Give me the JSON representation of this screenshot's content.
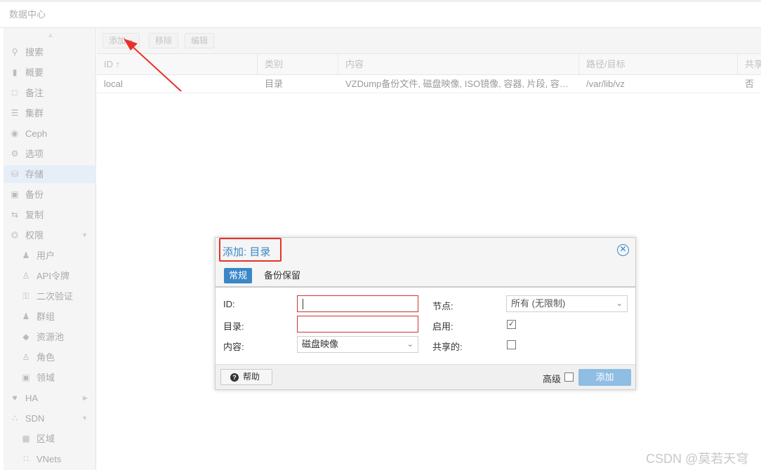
{
  "topbar": {
    "title": "数据中心"
  },
  "sidebar": {
    "items": [
      {
        "label": "搜索",
        "icon": "search-icon"
      },
      {
        "label": "概要",
        "icon": "book-icon"
      },
      {
        "label": "备注",
        "icon": "note-icon"
      },
      {
        "label": "集群",
        "icon": "server-icon"
      },
      {
        "label": "Ceph",
        "icon": "ceph-icon"
      },
      {
        "label": "选项",
        "icon": "gear-icon"
      },
      {
        "label": "存储",
        "icon": "database-icon",
        "active": true
      },
      {
        "label": "备份",
        "icon": "floppy-icon"
      },
      {
        "label": "复制",
        "icon": "retweet-icon"
      },
      {
        "label": "权限",
        "icon": "unlock-icon",
        "expanded": true
      },
      {
        "label": "用户",
        "icon": "user-icon"
      },
      {
        "label": "API令牌",
        "icon": "user-outline-icon"
      },
      {
        "label": "二次验证",
        "icon": "key-icon"
      },
      {
        "label": "群组",
        "icon": "users-icon"
      },
      {
        "label": "资源池",
        "icon": "tags-icon"
      },
      {
        "label": "角色",
        "icon": "male-icon"
      },
      {
        "label": "领域",
        "icon": "address-book-icon"
      },
      {
        "label": "HA",
        "icon": "heartbeat-icon"
      },
      {
        "label": "SDN",
        "icon": "sdn-icon",
        "expanded": true
      },
      {
        "label": "区域",
        "icon": "grid-icon"
      },
      {
        "label": "VNets",
        "icon": "sitemap-icon"
      }
    ]
  },
  "toolbar": {
    "add_label": "添加",
    "remove_label": "移除",
    "edit_label": "编辑"
  },
  "grid": {
    "columns": [
      "ID ↑",
      "类别",
      "内容",
      "路径/目标",
      "共享"
    ],
    "rows": [
      {
        "id": "local",
        "type": "目录",
        "content": "VZDump备份文件, 磁盘映像, ISO镜像, 容器, 片段, 容…",
        "path": "/var/lib/vz",
        "shared": "否"
      }
    ]
  },
  "dialog": {
    "title": "添加: 目录",
    "tabs": [
      "常规",
      "备份保留"
    ],
    "id_label": "ID:",
    "id_value": "",
    "directory_label": "目录:",
    "directory_value": "",
    "content_label": "内容:",
    "content_value": "磁盘映像",
    "nodes_label": "节点:",
    "nodes_value": "所有 (无限制)",
    "enable_label": "启用:",
    "enable_checked": true,
    "shared_label": "共享的:",
    "shared_checked": false,
    "help_label": "帮助",
    "advanced_label": "高级",
    "advanced_checked": false,
    "add_label": "添加"
  },
  "colors": {
    "accent": "#3a87c8",
    "annotation_red": "#e8312a",
    "add_button": "#8fbde4"
  },
  "watermark": "CSDN @莫若天穹"
}
